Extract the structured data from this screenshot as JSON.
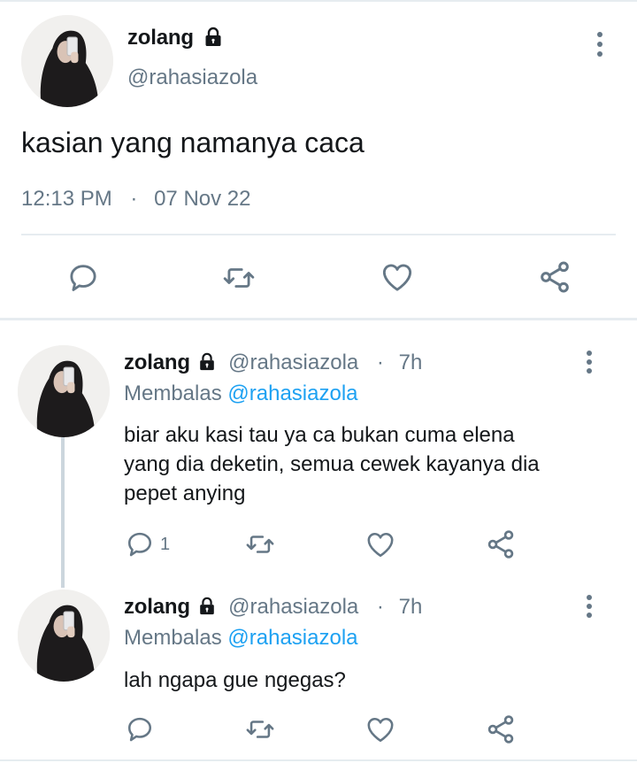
{
  "main_tweet": {
    "display_name": "zolang",
    "handle": "@rahasiazola",
    "text": "kasian yang namanya caca",
    "time": "12:13 PM",
    "separator": "·",
    "date": "07 Nov 22"
  },
  "replies": [
    {
      "display_name": "zolang",
      "handle": "@rahasiazola",
      "separator": "·",
      "age": "7h",
      "replying_prefix": "Membalas",
      "replying_to": "@rahasiazola",
      "text_lines": [
        "biar aku kasi tau ya ca bukan cuma elena",
        "yang dia deketin, semua cewek kayanya dia",
        "pepet anying"
      ],
      "reply_count": "1"
    },
    {
      "display_name": "zolang",
      "handle": "@rahasiazola",
      "separator": "·",
      "age": "7h",
      "replying_prefix": "Membalas",
      "replying_to": "@rahasiazola",
      "text_lines": [
        "lah ngapa gue ngegas?"
      ],
      "reply_count": ""
    }
  ],
  "icons": [
    "protected-lock-icon",
    "more-options-icon",
    "reply-icon",
    "retweet-icon",
    "like-icon",
    "share-icon"
  ],
  "colors": {
    "text": "#14171a",
    "muted": "#657786",
    "link": "#1da1f2",
    "divider": "#e6ecf0"
  }
}
